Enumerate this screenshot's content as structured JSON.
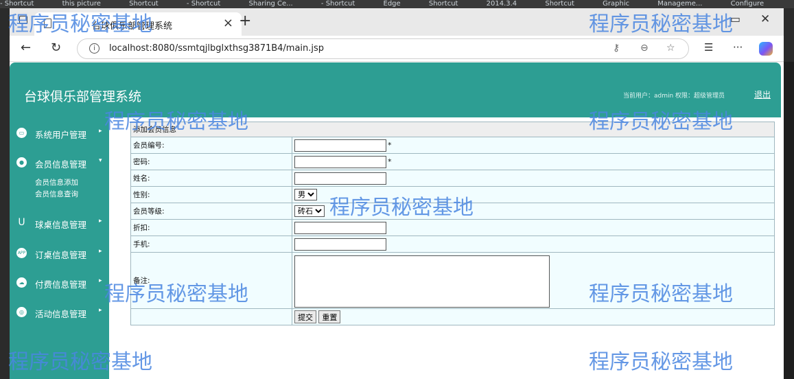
{
  "desktop": {
    "items": [
      "- Shortcut",
      "this picture",
      "Shortcut",
      "- Shortcut",
      "Sharing Ce...",
      "- Shortcut",
      "Edge",
      "Shortcut",
      "2014.3.4",
      "Shortcut",
      "Graphic",
      "Manageme...",
      "Configure"
    ]
  },
  "browser": {
    "tab_title": "台球俱乐部管理系统",
    "url": "localhost:8080/ssmtqjlbglxthsg3871B4/main.jsp"
  },
  "header": {
    "title": "台球俱乐部管理系统",
    "user_info": "当前用户：admin 权限：超级管理员",
    "logout": "退出"
  },
  "sidebar": {
    "items": [
      {
        "label": "系统用户管理",
        "icon": "monitor-icon"
      },
      {
        "label": "会员信息管理",
        "icon": "user-icon"
      },
      {
        "label": "球桌信息管理",
        "icon": "table-icon"
      },
      {
        "label": "订桌信息管理",
        "icon": "app-icon"
      },
      {
        "label": "付费信息管理",
        "icon": "cloud-icon"
      },
      {
        "label": "活动信息管理",
        "icon": "target-icon"
      }
    ],
    "sub_items": [
      "会员信息添加",
      "会员信息查询"
    ]
  },
  "form": {
    "heading": "添加会员信息",
    "fields": {
      "member_no": "会员编号:",
      "password": "密码:",
      "name": "姓名:",
      "gender": "性别:",
      "level": "会员等级:",
      "discount": "折扣:",
      "phone": "手机:",
      "remark": "备注:"
    },
    "required_mark": "*",
    "gender_value": "男",
    "level_value": "砖石",
    "submit": "提交",
    "reset": "重置"
  },
  "watermark": "程序员秘密基地"
}
